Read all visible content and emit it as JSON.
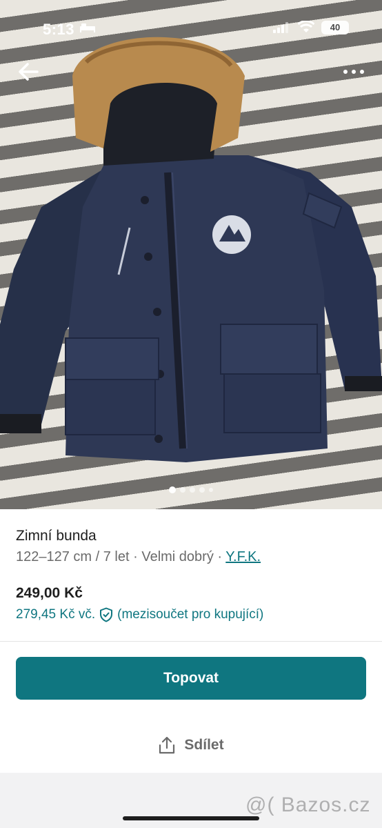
{
  "status_bar": {
    "time": "5:13",
    "battery": "40"
  },
  "photo": {
    "slide_count": 5,
    "active_slide": 1
  },
  "listing": {
    "title": "Zimní bunda",
    "size": "122–127 cm / 7 let",
    "condition": "Velmi dobrý",
    "brand": "Y.F.K.",
    "separator": " · ",
    "price": "249,00 Kč",
    "buyer_price": "279,45 Kč vč.",
    "buyer_note": "(mezisoučet pro kupující)"
  },
  "actions": {
    "topovat_label": "Topovat",
    "share_label": "Sdílet"
  },
  "watermark": "@( Bazos.cz",
  "colors": {
    "accent": "#0f7680",
    "jacket": "#2b3550",
    "fur": "#b88a4e"
  },
  "icons": [
    "back-arrow-icon",
    "more-icon",
    "shield-check-icon",
    "share-icon",
    "bed-icon",
    "signal-icon",
    "wifi-icon"
  ]
}
